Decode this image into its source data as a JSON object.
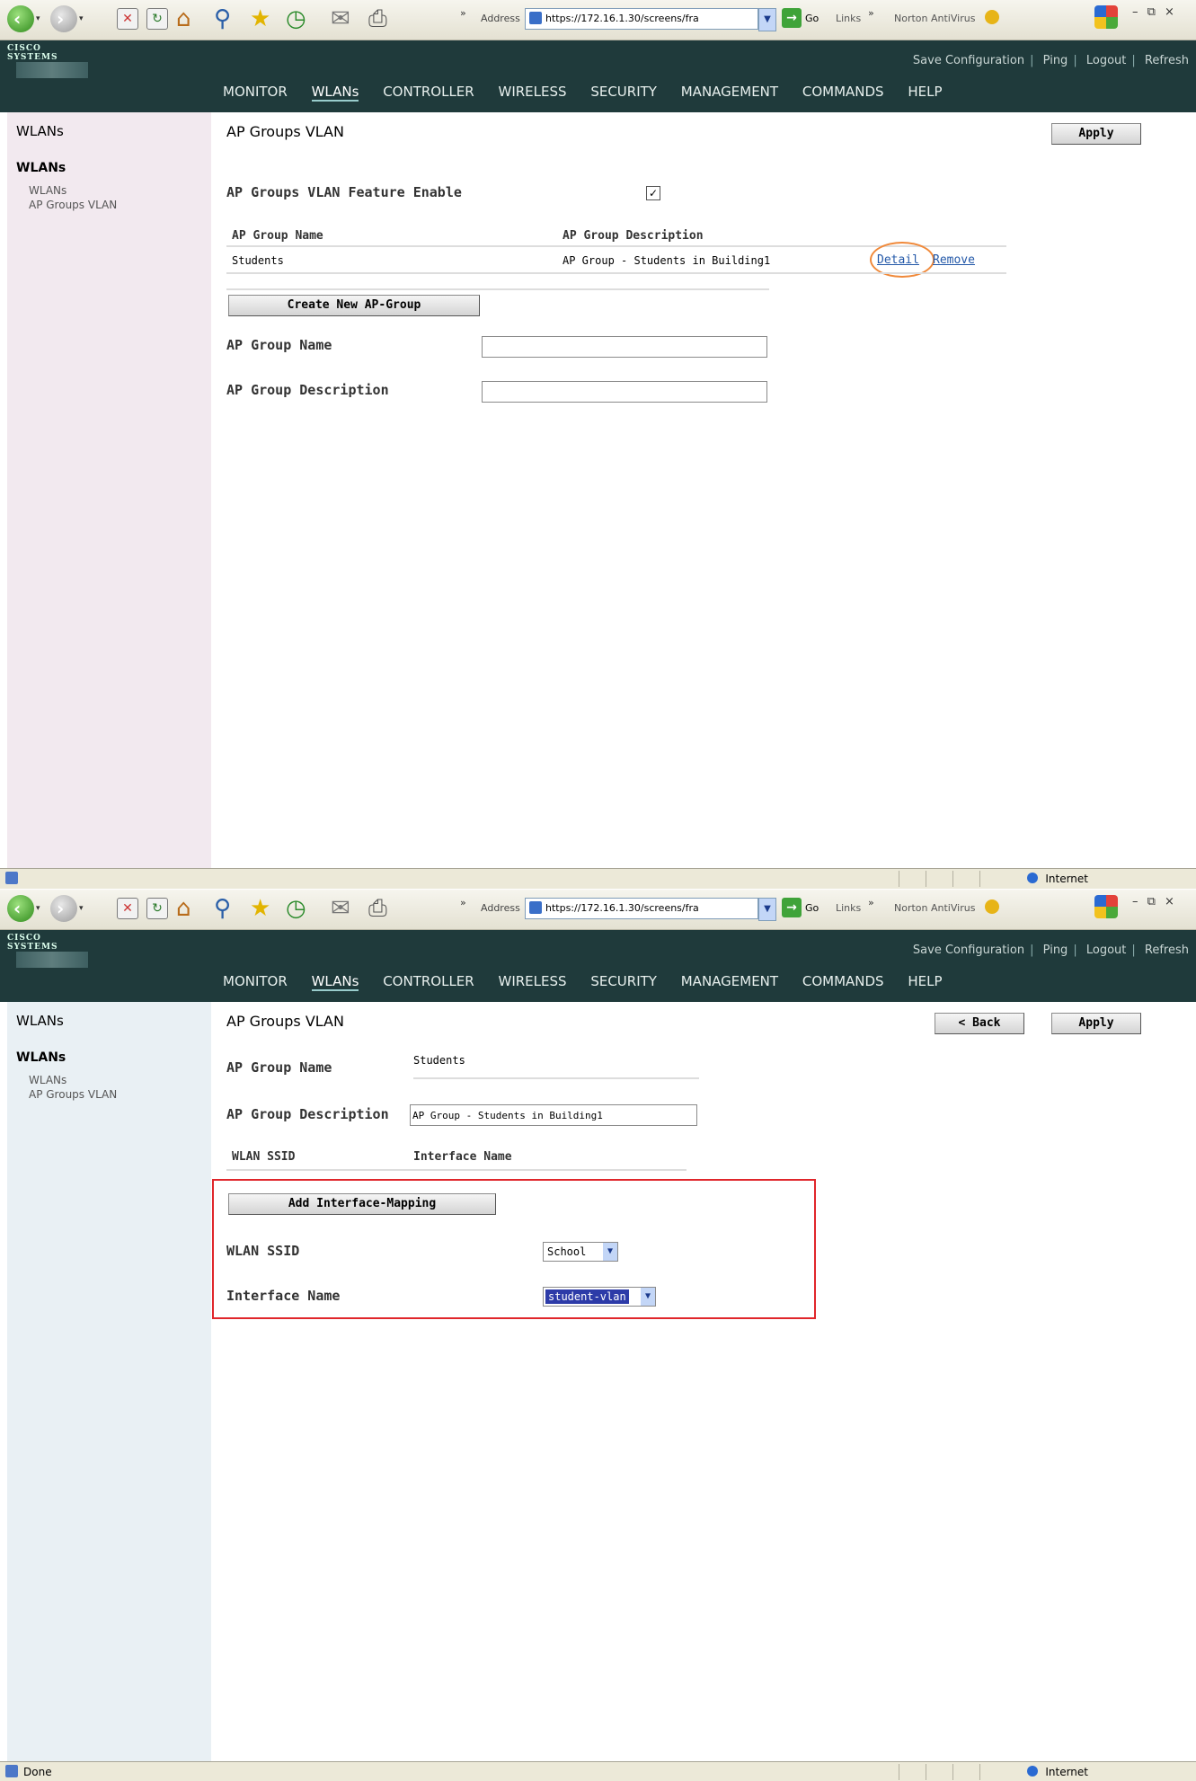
{
  "browser": {
    "address_label": "Address",
    "address_url": "https://172.16.1.30/screens/fra",
    "go_label": "Go",
    "links_label": "Links",
    "norton_label": "Norton AntiVirus",
    "window_controls": "– ⧉ ×"
  },
  "header": {
    "brand": "CISCO SYSTEMS",
    "util_links": [
      "Save Configuration",
      "Ping",
      "Logout",
      "Refresh"
    ],
    "nav": [
      "MONITOR",
      "WLANs",
      "CONTROLLER",
      "WIRELESS",
      "SECURITY",
      "MANAGEMENT",
      "COMMANDS",
      "HELP"
    ],
    "active_nav": "WLANs"
  },
  "sidebar": {
    "title": "WLANs",
    "group": "WLANs",
    "items": [
      "WLANs",
      "AP Groups VLAN"
    ]
  },
  "screen1": {
    "page_title": "AP Groups VLAN",
    "apply_label": "Apply",
    "feature_label": "AP Groups VLAN Feature Enable",
    "feature_checked": true,
    "table_headers": [
      "AP Group Name",
      "AP Group Description"
    ],
    "rows": [
      {
        "name": "Students",
        "description": "AP Group - Students in Building1",
        "detail": "Detail",
        "remove": "Remove"
      }
    ],
    "create_button": "Create New AP-Group",
    "group_name_label": "AP Group Name",
    "group_description_label": "AP Group Description",
    "group_name_value": "",
    "group_description_value": ""
  },
  "screen2": {
    "page_title": "AP Groups VLAN",
    "back_label": "< Back",
    "apply_label": "Apply",
    "group_name_label": "AP Group Name",
    "group_name_value": "Students",
    "group_description_label": "AP Group Description",
    "group_description_value": "AP Group - Students in Building1",
    "table_headers": [
      "WLAN SSID",
      "Interface Name"
    ],
    "add_button": "Add Interface-Mapping",
    "ssid_label": "WLAN SSID",
    "ssid_value": "School",
    "interface_label": "Interface Name",
    "interface_value": "student-vlan"
  },
  "status": {
    "screen1_text": "",
    "screen2_text": "Done",
    "zone": "Internet"
  },
  "colors": {
    "header_bg": "#1f3a3b",
    "sidebar_bg_screen1": "#f2e9ef",
    "sidebar_bg_screen2": "#e9f0f4",
    "highlight_oval": "#f0893a",
    "red_box": "#e0262b"
  }
}
